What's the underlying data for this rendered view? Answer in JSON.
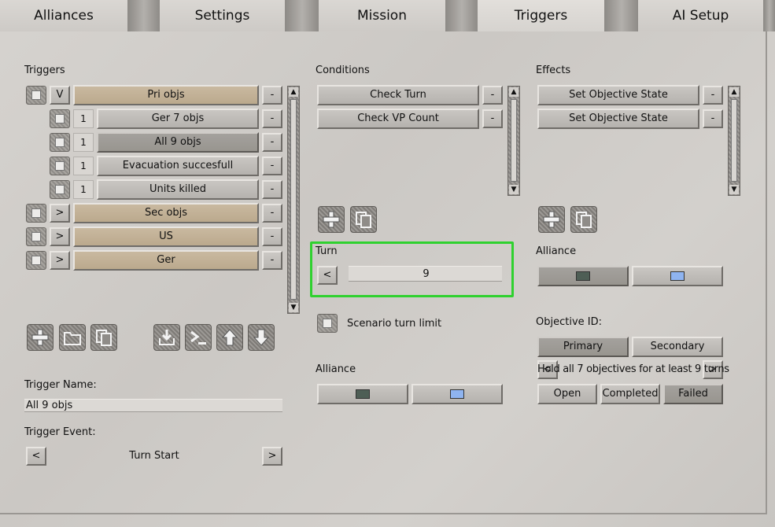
{
  "tabs": [
    "Alliances",
    "Settings",
    "Mission",
    "Triggers",
    "AI Setup"
  ],
  "selected_tab": "Triggers",
  "triggers": {
    "header": "Triggers",
    "rows": [
      {
        "toggle": "V",
        "name": "Pri objs",
        "group": true
      },
      {
        "num": "1",
        "name": "Ger 7 objs",
        "group": false
      },
      {
        "num": "1",
        "name": "All 9 objs",
        "group": false,
        "selected": true
      },
      {
        "num": "1",
        "name": "Evacuation succesfull",
        "group": false
      },
      {
        "num": "1",
        "name": "Units killed",
        "group": false
      },
      {
        "toggle": ">",
        "name": "Sec objs",
        "group": true
      },
      {
        "toggle": ">",
        "name": "US",
        "group": true
      },
      {
        "toggle": ">",
        "name": "Ger",
        "group": true
      }
    ],
    "remove_label": "-",
    "name_label": "Trigger Name:",
    "name_value": "All 9 objs",
    "event_label": "Trigger Event:",
    "event_value": "Turn Start",
    "prev": "<",
    "next": ">"
  },
  "conditions": {
    "header": "Conditions",
    "items": [
      "Check Turn",
      "Check VP Count"
    ],
    "remove_label": "-",
    "turn_label": "Turn",
    "turn_prev": "<",
    "turn_value": "9",
    "scenario_limit_label": "Scenario turn limit",
    "alliance_label": "Alliance"
  },
  "effects": {
    "header": "Effects",
    "items": [
      "Set Objective State",
      "Set Objective State"
    ],
    "remove_label": "-",
    "alliance_label": "Alliance",
    "objective_id_label": "Objective ID:",
    "primary": "Primary",
    "secondary": "Secondary",
    "objective_prev": "<",
    "objective_next": ">",
    "objective_text": "Hold all 7 objectives for at least 9 turns",
    "state_open": "Open",
    "state_completed": "Completed",
    "state_failed": "Failed"
  },
  "colors": {
    "alliance_1": "#4e5e55",
    "alliance_2": "#8fb4f0",
    "highlight": "#2fd12f"
  }
}
